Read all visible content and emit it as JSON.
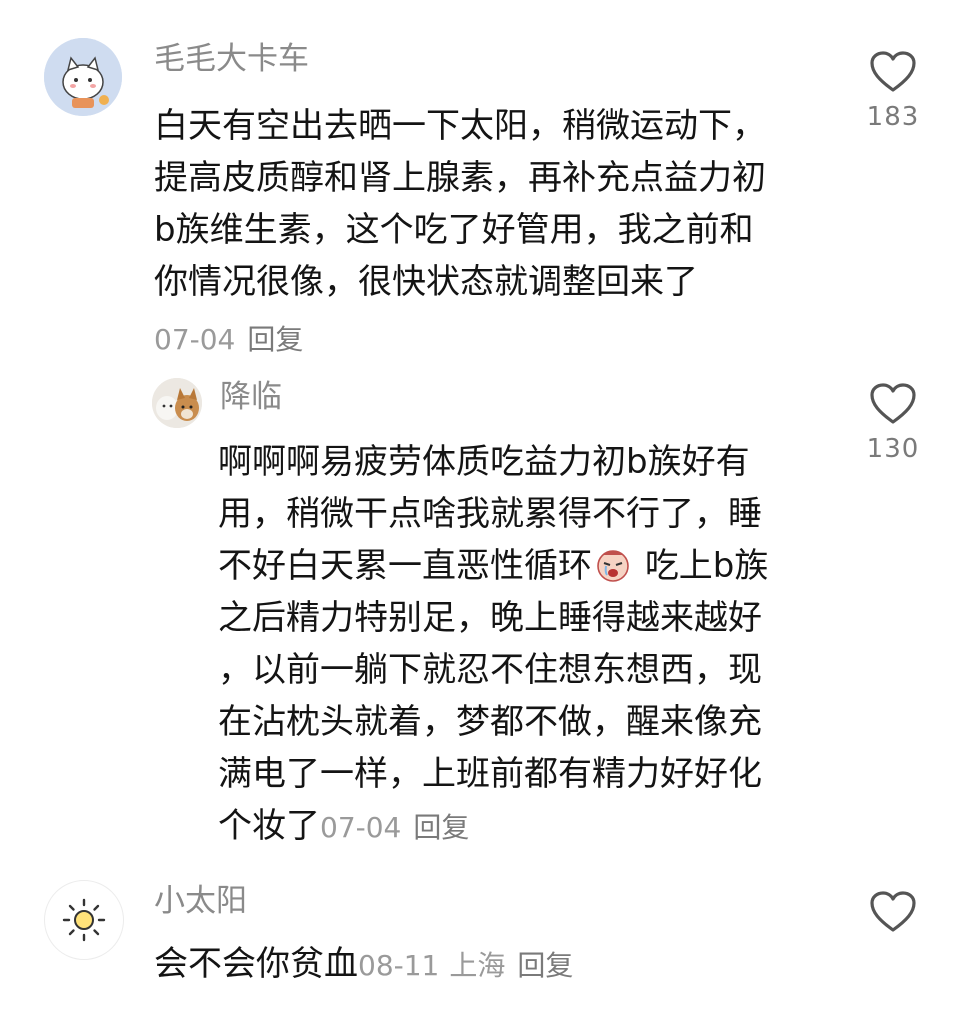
{
  "comments": [
    {
      "username": "毛毛大卡车",
      "avatar_icon": "cartoon-cat-icon",
      "lines": [
        "白天有空出去晒一下太阳，稍微运动下，",
        "提高皮质醇和肾上腺素，再补充点益力初",
        "b族维生素，这个吃了好管用，我之前和",
        "你情况很像，很快状态就调整回来了"
      ],
      "date": "07-04",
      "reply_label": "回复",
      "like_count": "183"
    },
    {
      "username": "降临",
      "avatar_icon": "dogs-photo-icon",
      "lines": [
        "啊啊啊易疲劳体质吃益力初b族好有",
        "用，稍微干点啥我就累得不行了，睡",
        "不好白天累一直恶性循环",
        "之后精力特别足，晚上睡得越来越好",
        "，以前一躺下就忍不住想东想西，现",
        "在沾枕头就着，梦都不做，醒来像充",
        "满电了一样，上班前都有精力好好化",
        "个妆了"
      ],
      "line3_after_emoji": "吃上b族",
      "emoji_icon": "crying-face-emoji-icon",
      "date": "07-04",
      "reply_label": "回复",
      "like_count": "130"
    },
    {
      "username": "小太阳",
      "avatar_icon": "sun-icon",
      "lines": [
        "会不会你贫血"
      ],
      "date": "08-11",
      "location": "上海",
      "reply_label": "回复",
      "like_count": ""
    }
  ]
}
